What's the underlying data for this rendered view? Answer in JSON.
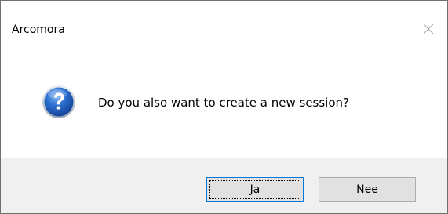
{
  "dialog": {
    "title": "Arcomora",
    "message": "Do you also want to create a new session?",
    "icon": "question-icon",
    "close_icon": "close-icon"
  },
  "buttons": {
    "yes": {
      "mnemonic": "J",
      "rest": "a",
      "full_label": "Ja"
    },
    "no": {
      "mnemonic": "N",
      "rest": "ee",
      "full_label": "Nee"
    }
  },
  "colors": {
    "footer_bg": "#f0f0f0",
    "button_bg": "#e1e1e1",
    "button_border": "#adadad",
    "default_button_border": "#0078d7",
    "icon_blue": "#1f5fbf"
  }
}
